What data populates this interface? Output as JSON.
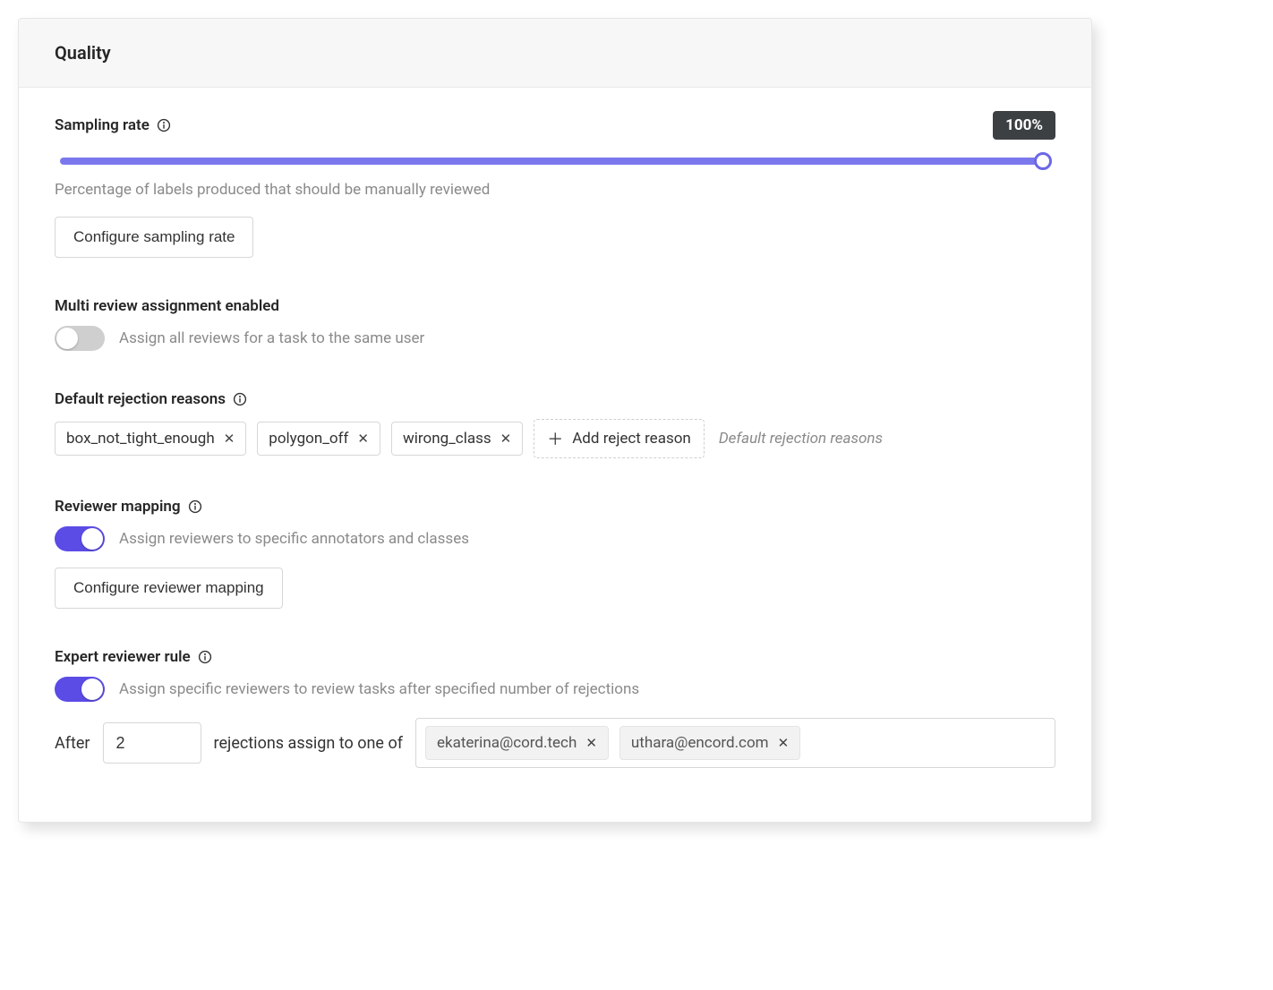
{
  "panel": {
    "title": "Quality"
  },
  "sampling": {
    "heading": "Sampling rate",
    "badge": "100%",
    "help": "Percentage of labels produced that should be manually reviewed",
    "configure_btn": "Configure sampling rate",
    "value_percent": 100
  },
  "multi_review": {
    "heading": "Multi review assignment enabled",
    "enabled": false,
    "description": "Assign all reviews for a task to the same user"
  },
  "rejection": {
    "heading": "Default rejection reasons",
    "reasons": [
      "box_not_tight_enough",
      "polygon_off",
      "wirong_class"
    ],
    "add_label": "Add reject reason",
    "placeholder": "Default rejection reasons"
  },
  "reviewer_mapping": {
    "heading": "Reviewer mapping",
    "enabled": true,
    "description": "Assign reviewers to specific annotators and classes",
    "configure_btn": "Configure reviewer mapping"
  },
  "expert": {
    "heading": "Expert reviewer rule",
    "enabled": true,
    "description": "Assign specific reviewers to review tasks after specified number of rejections",
    "after_label": "After",
    "rejections_value": "2",
    "rejections_label": "rejections assign to one of",
    "assignees": [
      "ekaterina@cord.tech",
      "uthara@encord.com"
    ]
  }
}
